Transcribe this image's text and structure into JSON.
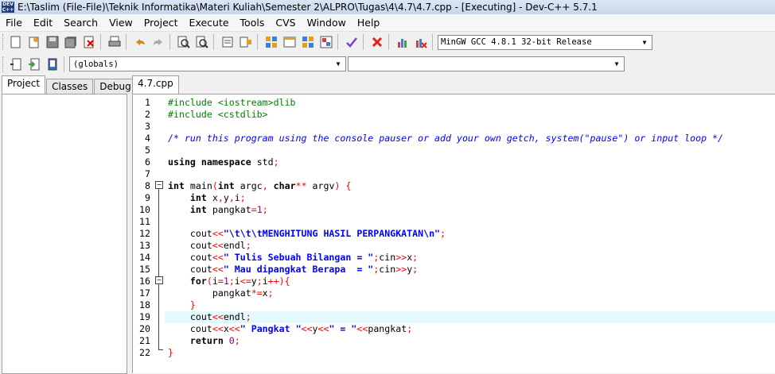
{
  "window": {
    "title": "E:\\Taslim (File-File)\\Teknik Informatika\\Materi Kuliah\\Semester 2\\ALPRO\\Tugas\\4\\4.7\\4.7.cpp - [Executing] - Dev-C++ 5.7.1",
    "icon_text": "DEV C++"
  },
  "menu": [
    "File",
    "Edit",
    "Search",
    "View",
    "Project",
    "Execute",
    "Tools",
    "CVS",
    "Window",
    "Help"
  ],
  "toolbar": {
    "compiler_select": "MinGW GCC 4.8.1 32-bit Release",
    "scope_select": "(globals)",
    "member_select": ""
  },
  "left_panel": {
    "tabs": [
      "Project",
      "Classes",
      "Debug"
    ]
  },
  "editor": {
    "file_tab": "4.7.cpp",
    "lines": [
      "#include <iostream>dlib",
      "#include <cstdlib>",
      "",
      "/* run this program using the console pauser or add your own getch, system(\"pause\") or input loop */",
      "",
      "using namespace std;",
      "",
      "int main(int argc, char** argv) {",
      "    int x,y,i;",
      "    int pangkat=1;",
      "",
      "    cout<<\"\\t\\t\\tMENGHITUNG HASIL PERPANGKATAN\\n\";",
      "    cout<<endl;",
      "    cout<<\" Tulis Sebuah Bilangan = \";cin>>x;",
      "    cout<<\" Mau dipangkat Berapa  = \";cin>>y;",
      "    for(i=1;i<=y;i++){",
      "        pangkat*=x;",
      "    }",
      "    cout<<endl;",
      "    cout<<x<<\" Pangkat \"<<y<<\" = \"<<pangkat;",
      "    return 0;",
      "}"
    ],
    "highlighted_line": 19
  },
  "colors": {
    "keyword": "#000000",
    "preprocessor": "#008000",
    "comment": "#0000ff",
    "string": "#0000ff",
    "number": "#800080",
    "symbol": "#ff0000",
    "current_line": "#e4f9fc"
  }
}
